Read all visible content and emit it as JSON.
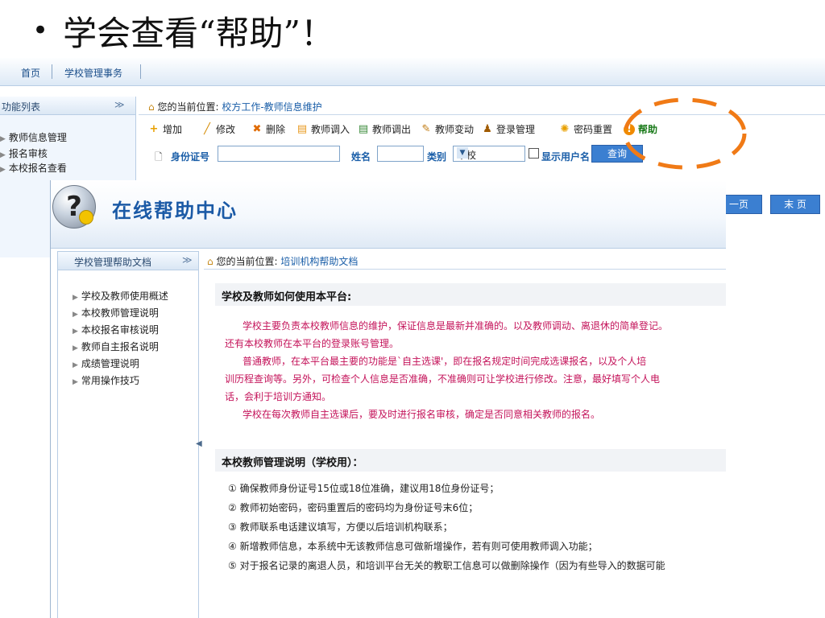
{
  "slide": {
    "bullet": "•",
    "title": "学会查看“帮助”！"
  },
  "bg_app": {
    "nav": {
      "home": "首页",
      "school_affairs": "学校管理事务"
    },
    "sidebar": {
      "title": "功能列表",
      "collapse": "≫",
      "items": [
        "教师信息管理",
        "报名审核",
        "本校报名查看"
      ]
    },
    "breadcrumb": {
      "label": "您的当前位置:",
      "path": "校方工作-教师信息维护"
    },
    "toolbar": [
      "增加",
      "修改",
      "删除",
      "教师调入",
      "教师调出",
      "教师变动",
      "登录管理",
      "密码重置",
      "帮助"
    ],
    "filter": {
      "id_label": "身份证号",
      "name_label": "姓名",
      "type_label": "类别",
      "type_value": "本校",
      "show_user_label": "显示用户名",
      "query_button": "查询"
    },
    "pager": {
      "prev": "一页",
      "last": "末 页"
    }
  },
  "help": {
    "title": "在线帮助中心",
    "sidebar": {
      "title": "学校管理帮助文档",
      "collapse": "≫",
      "items": [
        "学校及教师使用概述",
        "本校教师管理说明",
        "本校报名审核说明",
        "教师自主报名说明",
        "成绩管理说明",
        "常用操作技巧"
      ]
    },
    "breadcrumb": {
      "label": "您的当前位置:",
      "path": "培训机构帮助文档"
    },
    "section1": {
      "title": "学校及教师如何使用本平台:",
      "lines": [
        "学校主要负责本校教师信息的维护，保证信息是最新并准确的。以及教师调动、离退休的简单登记。",
        "还有本校教师在本平台的登录账号管理。",
        "普通教师，在本平台最主要的功能是`自主选课'，即在报名规定时间完成选课报名，以及个人培",
        "训历程查询等。另外，可检查个人信息是否准确，不准确则可让学校进行修改。注意，最好填写个人电",
        "话，会利于培训方通知。",
        "学校在每次教师自主选课后，要及时进行报名审核，确定是否同意相关教师的报名。"
      ]
    },
    "section2": {
      "title": "本校教师管理说明（学校用）：",
      "items": [
        "① 确保教师身份证号15位或18位准确，建议用18位身份证号；",
        "② 教师初始密码，密码重置后的密码均为身份证号末6位；",
        "③ 教师联系电话建议填写，方便以后培训机构联系；",
        "④ 新增教师信息，本系统中无该教师信息可做新增操作，若有则可使用教师调入功能；",
        "⑤ 对于报名记录的离退人员，和培训平台无关的教职工信息可以做删除操作（因为有些导入的数据可能"
      ]
    }
  },
  "colors": {
    "link_blue": "#1a5ea8",
    "title_blue": "#1b5aa6",
    "para_magenta": "#c4135a",
    "highlight_orange": "#f07a16"
  },
  "icons": [
    "home-icon",
    "plus-icon",
    "pencil-icon",
    "delete-x-icon",
    "import-icon",
    "export-icon",
    "wrench-icon",
    "login-icon",
    "gear-icon",
    "info-icon",
    "question-mark-icon",
    "document-icon"
  ]
}
